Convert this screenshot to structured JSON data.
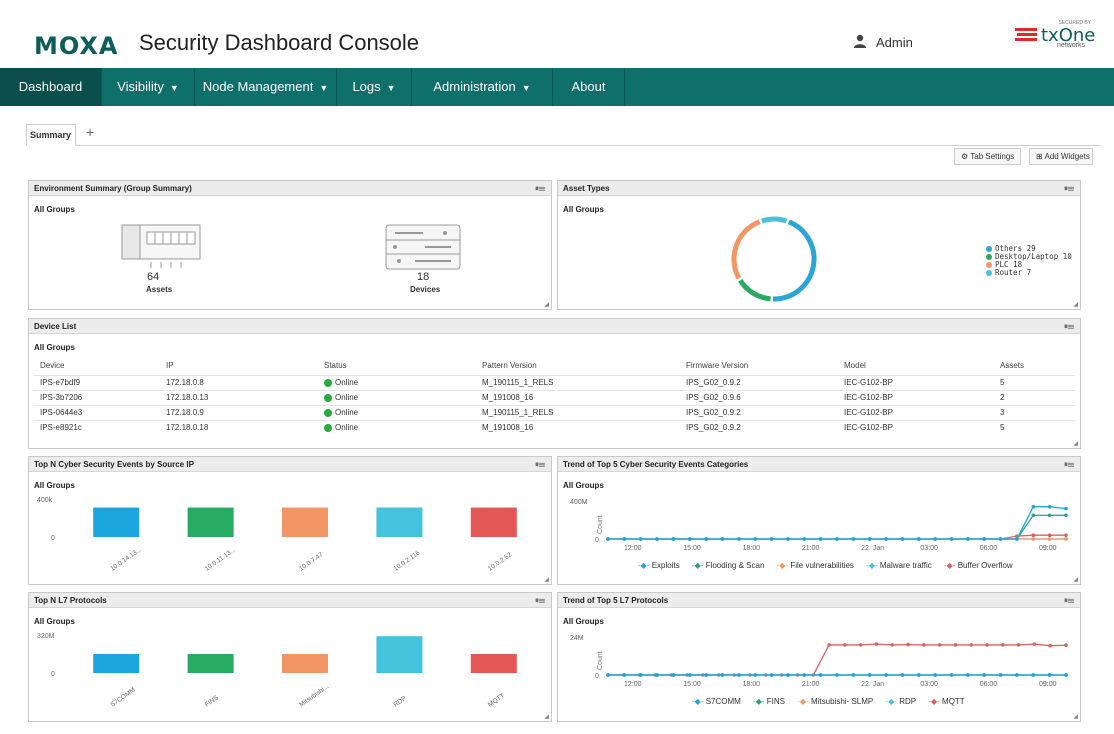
{
  "header": {
    "logo": "MOXA",
    "title": "Security Dashboard Console",
    "user": "Admin",
    "badge_secured": "SECURED BY",
    "badge_name": "txOne",
    "badge_sub": "networks"
  },
  "nav": [
    "Dashboard",
    "Visibility",
    "Node Management",
    "Logs",
    "Administration",
    "About"
  ],
  "tabs": {
    "active": "Summary",
    "add": "+"
  },
  "toolbar": {
    "tab_settings": "Tab Settings",
    "add_widgets": "Add Widgets"
  },
  "env": {
    "title": "Environment Summary (Group Summary)",
    "group": "All Groups",
    "assets_count": "64",
    "assets_label": "Assets",
    "devices_count": "18",
    "devices_label": "Devices"
  },
  "asset_types": {
    "title": "Asset Types",
    "group": "All Groups",
    "slices": [
      {
        "label": "Others 29",
        "value": 29,
        "color": "#2aa5d6"
      },
      {
        "label": "Desktop/Laptop 10",
        "value": 10,
        "color": "#27ab62"
      },
      {
        "label": "PLC 18",
        "value": 18,
        "color": "#f29666"
      },
      {
        "label": "Router 7",
        "value": 7,
        "color": "#45c2dc"
      }
    ]
  },
  "device_list": {
    "title": "Device List",
    "group": "All Groups",
    "columns": [
      "Device",
      "IP",
      "Status",
      "Pattern Version",
      "Firmware Version",
      "Model",
      "Assets"
    ],
    "rows": [
      [
        "IPS-e7bdf9",
        "172.18.0.8",
        "Online",
        "M_190115_1_RELS",
        "IPS_G02_0.9.2",
        "IEC-G102-BP",
        "5"
      ],
      [
        "IPS-3b7206",
        "172.18.0.13",
        "Online",
        "M_191008_16",
        "IPS_G02_0.9.6",
        "IEC-G102-BP",
        "2"
      ],
      [
        "IPS-0644e3",
        "172.18.0.9",
        "Online",
        "M_190115_1_RELS",
        "IPS_G02_0.9.2",
        "IEC-G102-BP",
        "3"
      ],
      [
        "IPS-e8921c",
        "172.18.0.18",
        "Online",
        "M_191008_16",
        "IPS_G02_0.9.2",
        "IEC-G102-BP",
        "5"
      ]
    ]
  },
  "panel_titles": {
    "cyber_src": "Top N Cyber Security Events by Source IP",
    "cyber_trend": "Trend of Top 5 Cyber Security Events Categories",
    "l7": "Top N L7 Protocols",
    "l7_trend": "Trend of Top 5 L7 Protocols",
    "group": "All Groups"
  },
  "chart_data": [
    {
      "type": "bar",
      "title": "Top N Cyber Security Events by Source IP",
      "categories": [
        "10.0.14.13...",
        "10.0.11.13...",
        "10.0.7.47",
        "10.0.2.116",
        "10.0.2.52"
      ],
      "values": [
        310000,
        310000,
        310000,
        310000,
        310000
      ],
      "colors": [
        "#1ba7dd",
        "#27ab62",
        "#f29666",
        "#45c2dc",
        "#e35757"
      ],
      "yticks": [
        "0",
        "400k"
      ],
      "ylim": [
        0,
        400000
      ]
    },
    {
      "type": "line",
      "title": "Trend of Top 5 Cyber Security Events Categories",
      "ylabel": "Count",
      "yticks": [
        "0",
        "400M"
      ],
      "ylim": [
        0,
        400000000
      ],
      "x": [
        "12:00",
        "15:00",
        "18:00",
        "21:00",
        "22. Jan",
        "03:00",
        "06:00",
        "09:00"
      ],
      "series": [
        {
          "name": "Exploits",
          "color": "#1ba7dd",
          "values": [
            0,
            0,
            0,
            0,
            0,
            0,
            0,
            0,
            0,
            0,
            0,
            0,
            0,
            0,
            0,
            0,
            0,
            0,
            0,
            0,
            0,
            0,
            0,
            0,
            0,
            0,
            340000000,
            340000000,
            320000000
          ]
        },
        {
          "name": "Flooding & Scan",
          "color": "#2b9e86",
          "values": [
            0,
            0,
            0,
            0,
            0,
            0,
            0,
            0,
            0,
            0,
            0,
            0,
            0,
            0,
            0,
            0,
            0,
            0,
            0,
            0,
            0,
            0,
            0,
            0,
            0,
            0,
            250000000,
            250000000,
            250000000
          ]
        },
        {
          "name": "File vulnerabilities",
          "color": "#f29666",
          "values": [
            0,
            0,
            0,
            0,
            0,
            0,
            0,
            0,
            0,
            0,
            0,
            0,
            0,
            0,
            0,
            0,
            0,
            0,
            0,
            0,
            0,
            0,
            0,
            0,
            0,
            0,
            0,
            0,
            0
          ]
        },
        {
          "name": "Malware traffic",
          "color": "#45c2dc",
          "values": [
            0,
            0,
            0,
            0,
            0,
            0,
            0,
            0,
            0,
            0,
            0,
            0,
            0,
            0,
            0,
            0,
            0,
            0,
            0,
            0,
            0,
            0,
            0,
            0,
            0,
            0,
            0,
            0,
            0
          ]
        },
        {
          "name": "Buffer Overflow",
          "color": "#d9625f",
          "values": [
            0,
            0,
            0,
            0,
            0,
            0,
            0,
            0,
            0,
            0,
            0,
            0,
            0,
            0,
            0,
            0,
            0,
            0,
            0,
            0,
            0,
            0,
            0,
            0,
            0,
            30000000,
            40000000,
            40000000,
            40000000
          ]
        }
      ]
    },
    {
      "type": "bar",
      "title": "Top N L7 Protocols",
      "categories": [
        "S7COMM",
        "FINS",
        "Mitsubishi...",
        "RDP",
        "MQTT"
      ],
      "values": [
        160000000,
        160000000,
        160000000,
        310000000,
        160000000
      ],
      "colors": [
        "#1ba7dd",
        "#27ab62",
        "#f29666",
        "#45c2dc",
        "#e35757"
      ],
      "yticks": [
        "0",
        "320M"
      ],
      "ylim": [
        0,
        320000000
      ]
    },
    {
      "type": "line",
      "title": "Trend of Top 5 L7 Protocols",
      "ylabel": "Count",
      "yticks": [
        "0",
        "24M"
      ],
      "ylim": [
        0,
        24000000
      ],
      "x": [
        "12:00",
        "15:00",
        "18:00",
        "21:00",
        "22. Jan",
        "03:00",
        "06:00",
        "09:00"
      ],
      "series": [
        {
          "name": "S7COMM",
          "color": "#1ba7dd",
          "values": [
            0,
            0,
            0,
            0,
            0,
            0,
            0,
            0,
            0,
            0,
            0,
            0,
            0,
            0,
            0,
            0,
            0,
            0,
            0,
            0,
            0,
            0,
            0,
            0,
            0,
            0,
            0,
            0,
            0
          ]
        },
        {
          "name": "FINS",
          "color": "#2b9e86",
          "values": [
            0,
            0,
            0,
            0,
            0,
            0,
            0,
            0,
            0,
            0,
            0,
            0,
            0,
            0,
            0,
            0,
            0,
            0,
            0,
            0,
            0,
            0,
            0,
            0,
            0,
            0,
            0,
            0,
            0
          ]
        },
        {
          "name": "Mitsubishi- SLMP",
          "color": "#f29666",
          "values": [
            0,
            0,
            0,
            0,
            0,
            0,
            0,
            0,
            0,
            0,
            0,
            0,
            0,
            0,
            0,
            0,
            0,
            0,
            0,
            0,
            0,
            0,
            0,
            0,
            0,
            0,
            0,
            0,
            0
          ]
        },
        {
          "name": "RDP",
          "color": "#45c2dc",
          "values": [
            0,
            0,
            0,
            0,
            0,
            0,
            0,
            0,
            0,
            0,
            0,
            0,
            0,
            0,
            0,
            0,
            0,
            0,
            0,
            0,
            0,
            0,
            0,
            0,
            0,
            0,
            0,
            0,
            0
          ]
        },
        {
          "name": "MQTT",
          "color": "#d9625f",
          "values": [
            0,
            0,
            0,
            0,
            0,
            0,
            0,
            0,
            0,
            0,
            0,
            0,
            0,
            0,
            19000000,
            19000000,
            19000000,
            19500000,
            19000000,
            19200000,
            19000000,
            19000000,
            19000000,
            19000000,
            19000000,
            19000000,
            19000000,
            19500000,
            18500000,
            18800000
          ]
        }
      ]
    }
  ]
}
